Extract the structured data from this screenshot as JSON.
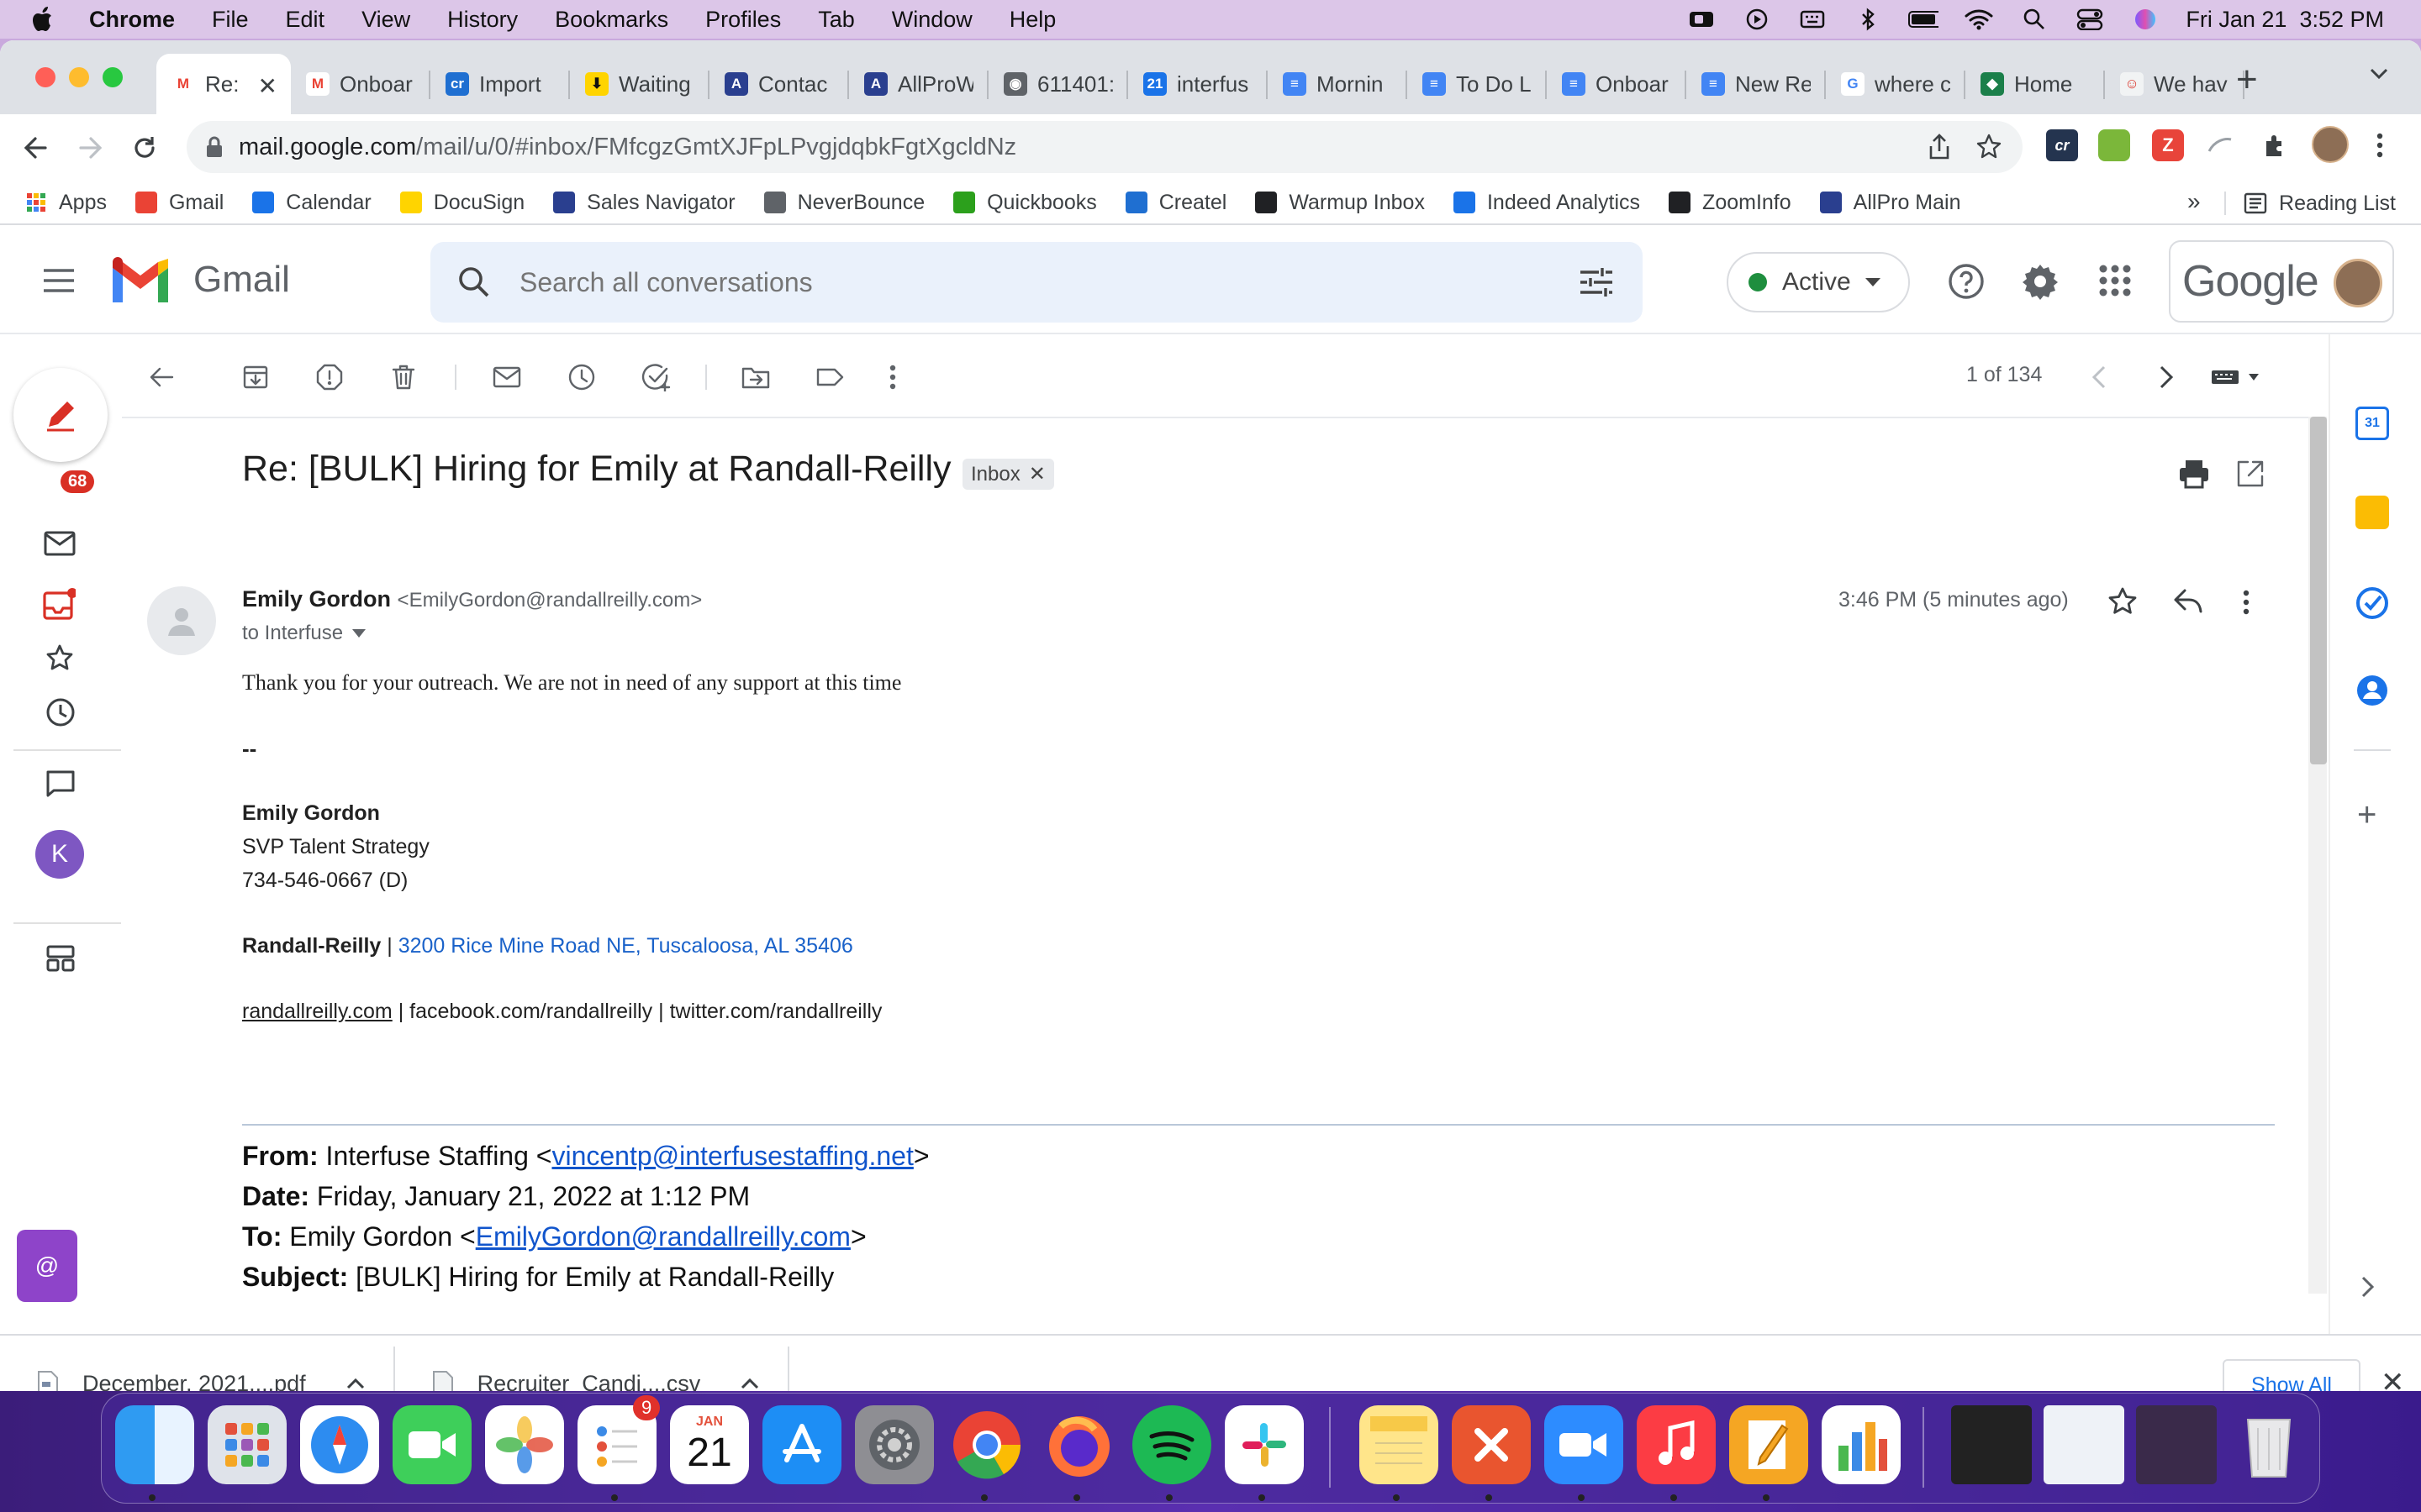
{
  "menubar": {
    "app": "Chrome",
    "items": [
      "File",
      "Edit",
      "View",
      "History",
      "Bookmarks",
      "Profiles",
      "Tab",
      "Window",
      "Help"
    ],
    "clock": "Fri Jan 21  3:52 PM"
  },
  "tabs": [
    {
      "title": "Re:",
      "fav": "gmail",
      "active": true
    },
    {
      "title": "Onboar",
      "fav": "gmail"
    },
    {
      "title": "Import",
      "fav": "cr"
    },
    {
      "title": "Waiting",
      "fav": "docusign"
    },
    {
      "title": "Contac",
      "fav": "allpro"
    },
    {
      "title": "AllProW",
      "fav": "allpro"
    },
    {
      "title": "611401:",
      "fav": "globe"
    },
    {
      "title": "interfus",
      "fav": "calendar"
    },
    {
      "title": "Mornin",
      "fav": "docs"
    },
    {
      "title": "To Do L",
      "fav": "docs"
    },
    {
      "title": "Onboar",
      "fav": "docs"
    },
    {
      "title": "New Re",
      "fav": "docs"
    },
    {
      "title": "where c",
      "fav": "google"
    },
    {
      "title": "Home",
      "fav": "home"
    },
    {
      "title": "We hav",
      "fav": "misc"
    }
  ],
  "address": {
    "host": "mail.google.com",
    "path": "/mail/u/0/#inbox/FMfcgzGmtXJFpLPvgjdqbkFgtXgcldNz"
  },
  "bookmarks": [
    "Apps",
    "Gmail",
    "Calendar",
    "DocuSign",
    "Sales Navigator",
    "NeverBounce",
    "Quickbooks",
    "Createl",
    "Warmup Inbox",
    "Indeed Analytics",
    "ZoomInfo",
    "AllPro Main"
  ],
  "bookmarks_overflow": "»",
  "reading_list": "Reading List",
  "gmail": {
    "logo_text": "Gmail",
    "search_placeholder": "Search all conversations",
    "status": "Active",
    "google_logo": "Google",
    "unread_badge": "68",
    "account_initial": "K",
    "pager": "1 of 134"
  },
  "email": {
    "subject": "Re: [BULK] Hiring for Emily at Randall-Reilly",
    "label": "Inbox",
    "sender_name": "Emily Gordon",
    "sender_email": "<EmilyGordon@randallreilly.com>",
    "to_line": "to Interfuse",
    "time": "3:46 PM (5 minutes ago)",
    "body_line": "Thank you for your outreach. We are not in need of any support at this time",
    "sig_sep": "--",
    "sig_name": "Emily Gordon",
    "sig_title": "SVP Talent Strategy",
    "sig_phone": "734-546-0667 (D)",
    "sig_company": "Randall-Reilly",
    "sig_pipe": " | ",
    "sig_address": "3200 Rice Mine Road NE, Tuscaloosa, AL 35406",
    "sig_site": "randallreilly.com",
    "sig_social": " | facebook.com/randallreilly | twitter.com/randallreilly",
    "quote": {
      "from_label": "From:",
      "from_name": " Interfuse Staffing <",
      "from_email": "vincentp@interfusestaffing.net",
      "from_end": ">",
      "date_label": "Date:",
      "date_value": " Friday, January 21, 2022 at 1:12 PM",
      "to_label": "To:",
      "to_name": " Emily Gordon <",
      "to_email": "EmilyGordon@randallreilly.com",
      "to_end": ">",
      "subject_label": "Subject:",
      "subject_value": " [BULK] Hiring for Emily at Randall-Reilly"
    }
  },
  "downloads": [
    {
      "name": "December, 2021....pdf"
    },
    {
      "name": "Recruiter_Candi....csv"
    }
  ],
  "downloads_show_all": "Show All",
  "dock": {
    "reminders_badge": "9",
    "calendar_month": "JAN",
    "calendar_day": "21"
  },
  "colors": {
    "gmail_red": "#ea4335",
    "link": "#1a62c9",
    "active_green": "#1e8e3e"
  }
}
